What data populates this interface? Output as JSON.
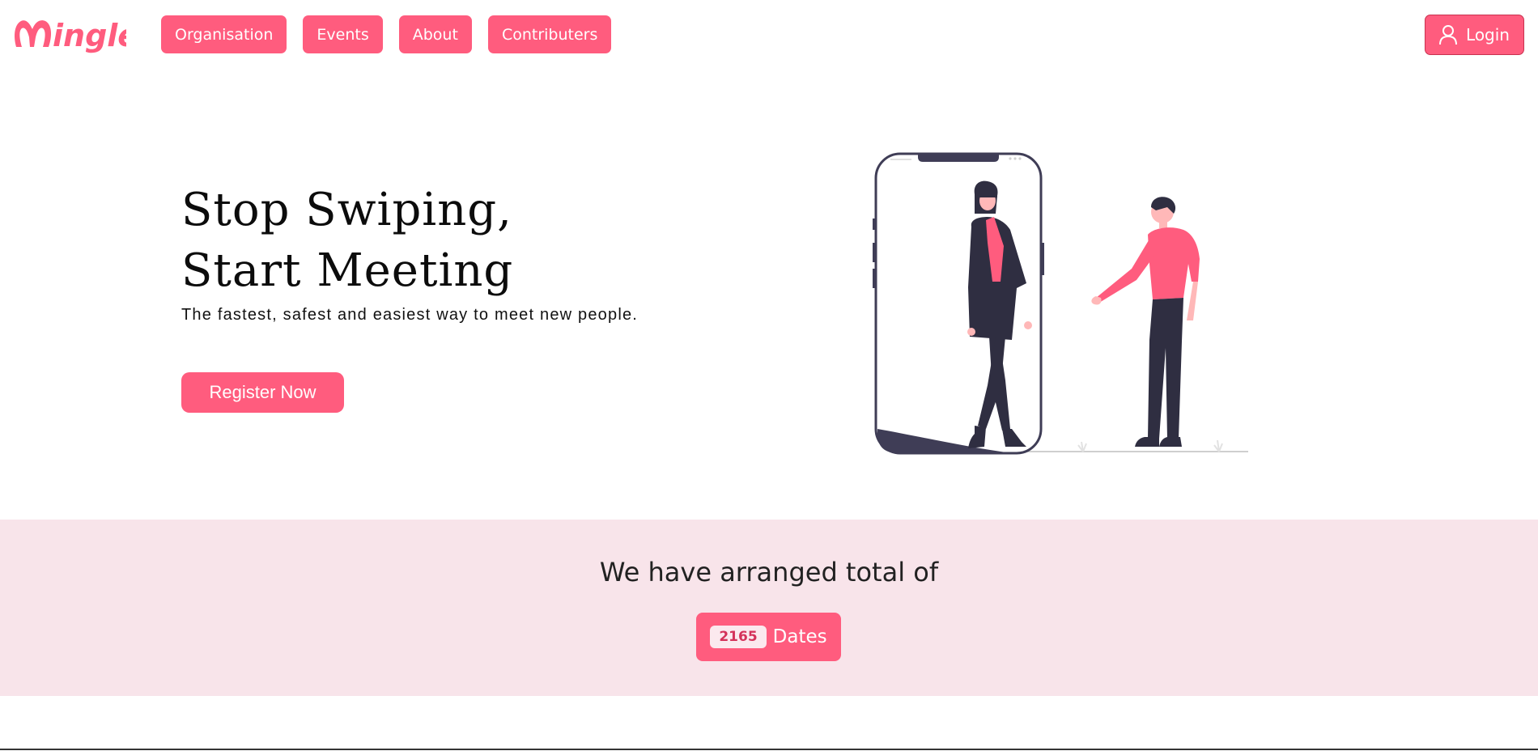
{
  "brand": {
    "logo_text": "mingle",
    "accent_color": "#ff5c7e"
  },
  "nav": {
    "items": [
      {
        "label": "Organisation"
      },
      {
        "label": "Events"
      },
      {
        "label": "About"
      },
      {
        "label": "Contributers"
      }
    ],
    "login_label": "Login",
    "login_icon": "user-icon"
  },
  "hero": {
    "title_line1": "Stop Swiping,",
    "title_line2": "Start Meeting",
    "subtitle": "The fastest, safest and easiest way to meet new people.",
    "register_label": "Register Now",
    "illustration": "couple-meeting-phone-illustration"
  },
  "stats": {
    "heading": "We have arranged total of",
    "count": "2165",
    "count_label": "Dates",
    "band_color": "#f8e4ea"
  }
}
